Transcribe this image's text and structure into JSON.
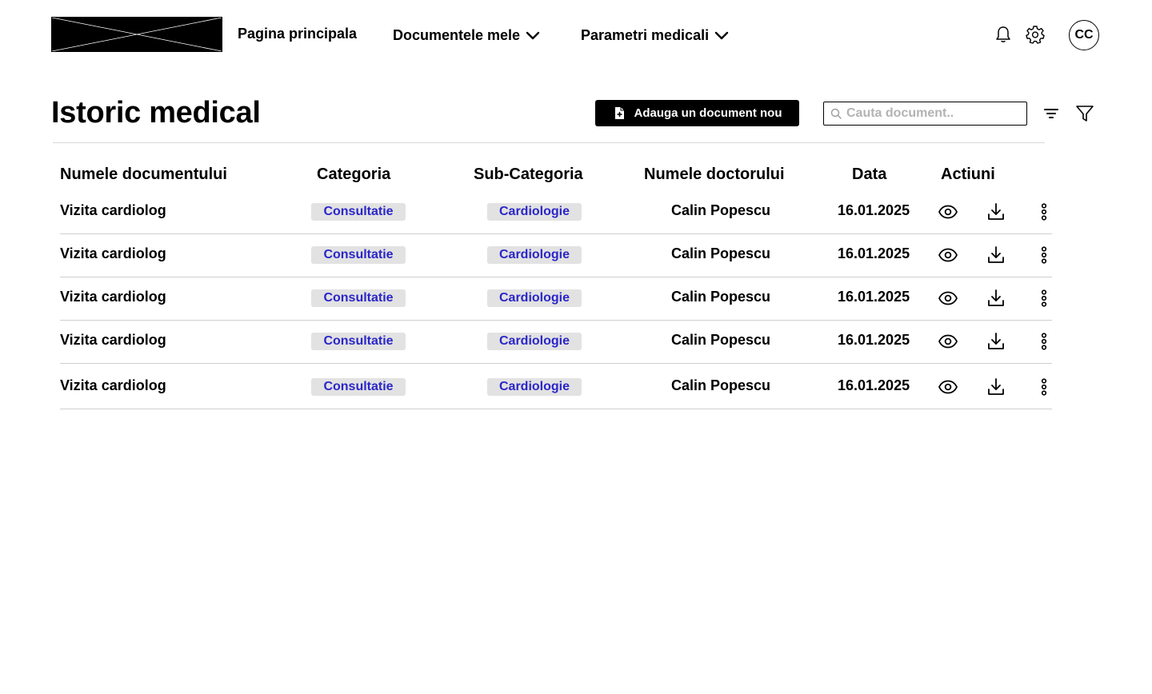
{
  "header": {
    "nav": {
      "home": "Pagina principala",
      "documents": "Documentele mele",
      "parameters": "Parametri medicali"
    },
    "avatar_initials": "CC",
    "icons": [
      "bell-icon",
      "gear-icon",
      "chevron-down-icon"
    ]
  },
  "page": {
    "title": "Istoric medical",
    "add_button_label": "Adauga un document nou",
    "search_placeholder": "Cauta document..",
    "toolbar_icons": [
      "sort-icon",
      "filter-icon"
    ]
  },
  "table": {
    "columns": {
      "name": "Numele documentului",
      "category": "Categoria",
      "subcategory": "Sub-Categoria",
      "doctor": "Numele doctorului",
      "date": "Data",
      "actions": "Actiuni"
    },
    "rows": [
      {
        "name": "Vizita cardiolog",
        "category": "Consultatie",
        "subcategory": "Cardiologie",
        "doctor": "Calin Popescu",
        "date": "16.01.2025"
      },
      {
        "name": "Vizita cardiolog",
        "category": "Consultatie",
        "subcategory": "Cardiologie",
        "doctor": "Calin Popescu",
        "date": "16.01.2025"
      },
      {
        "name": "Vizita cardiolog",
        "category": "Consultatie",
        "subcategory": "Cardiologie",
        "doctor": "Calin Popescu",
        "date": "16.01.2025"
      },
      {
        "name": "Vizita cardiolog",
        "category": "Consultatie",
        "subcategory": "Cardiologie",
        "doctor": "Calin Popescu",
        "date": "16.01.2025"
      },
      {
        "name": "Vizita cardiolog",
        "category": "Consultatie",
        "subcategory": "Cardiologie",
        "doctor": "Calin Popescu",
        "date": "16.01.2025"
      }
    ],
    "action_icons": [
      "eye-icon",
      "download-icon",
      "more-vertical-icon"
    ]
  },
  "colors": {
    "badge_text": "#2b26c9",
    "badge_bg": "#e2e2e2",
    "primary_button_bg": "#000000"
  }
}
